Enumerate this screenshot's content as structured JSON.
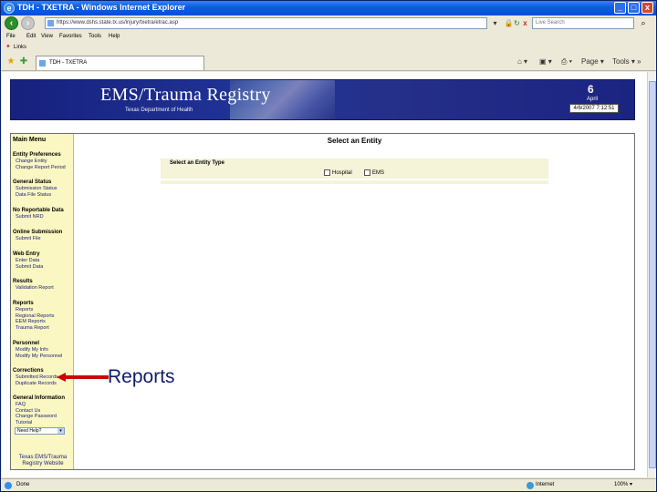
{
  "window": {
    "title": "TDH - TXETRA - Windows Internet Explorer",
    "min_label": "_",
    "max_label": "□",
    "close_label": "x"
  },
  "nav": {
    "back_label": "‹",
    "forward_label": "›",
    "address": "https://www.dshs.state.tx.us/injury/txetra/etrac.asp",
    "refresh_label": "↻",
    "stop_label": "x",
    "search_placeholder": "Live Search",
    "search_go_label": "⌕"
  },
  "menubar": {
    "file": "File",
    "edit": "Edit",
    "view": "View",
    "favorites": "Favorites",
    "tools": "Tools",
    "help": "Help"
  },
  "links_bar": {
    "label": "Links"
  },
  "tab": {
    "label": "TDH - TXETRA",
    "star_icon": "★",
    "add_icon": "✚",
    "home_label": "⌂ ▾",
    "feeds_label": "▣ ▾",
    "print_label": "⎙ ▾",
    "page_label": "Page ▾",
    "tools_label": "Tools ▾ »"
  },
  "banner": {
    "title": "EMS/Trauma  Registry",
    "subtitle": "Texas Department of Health",
    "day": "6",
    "month": "April",
    "date": "4/6/2007 7:12:51"
  },
  "sidebar": {
    "title": "Main Menu",
    "sections": {
      "entity_prefs": {
        "head": "Entity Preferences",
        "links": [
          "Change Entity",
          "Change Report Period"
        ]
      },
      "general_status": {
        "head": "General Status",
        "links": [
          "Submission Status",
          "Data File Status"
        ]
      },
      "no_reportable": {
        "head": "No Reportable Data",
        "links": [
          "Submit NRD"
        ]
      },
      "online_submission": {
        "head": "Online Submission",
        "links": [
          "Submit File"
        ]
      },
      "web_entry": {
        "head": "Web Entry",
        "links": [
          "Enter Data",
          "Submit Data"
        ]
      },
      "results": {
        "head": "Results",
        "links": [
          "Validation Report"
        ]
      },
      "reports": {
        "head": "Reports",
        "links": [
          "Reports",
          "Regional Reports",
          "EEM Reports",
          "Trauma Report"
        ]
      },
      "personnel": {
        "head": "Personnel",
        "links": [
          "Modify My Info",
          "Modify My Personnel"
        ]
      },
      "corrections": {
        "head": "Corrections",
        "links": [
          "Submitted Records",
          "Duplicate Records"
        ]
      },
      "general_info": {
        "head": "General Information",
        "links": [
          "FAQ",
          "Contact Us",
          "Change Password",
          "Tutorial"
        ]
      }
    },
    "select_value": "Need Help?",
    "footer": "Texas EMS/Trauma Registry Website"
  },
  "content": {
    "title": "Select an Entity",
    "entity_type_label": "Select an Entity Type",
    "option_hospital": "Hospital",
    "option_ems": "EMS"
  },
  "annotation": {
    "label": "Reports",
    "color": "#cc0000"
  },
  "status": {
    "text": "Done",
    "zone": "Internet",
    "zoom": "100% ▾"
  }
}
